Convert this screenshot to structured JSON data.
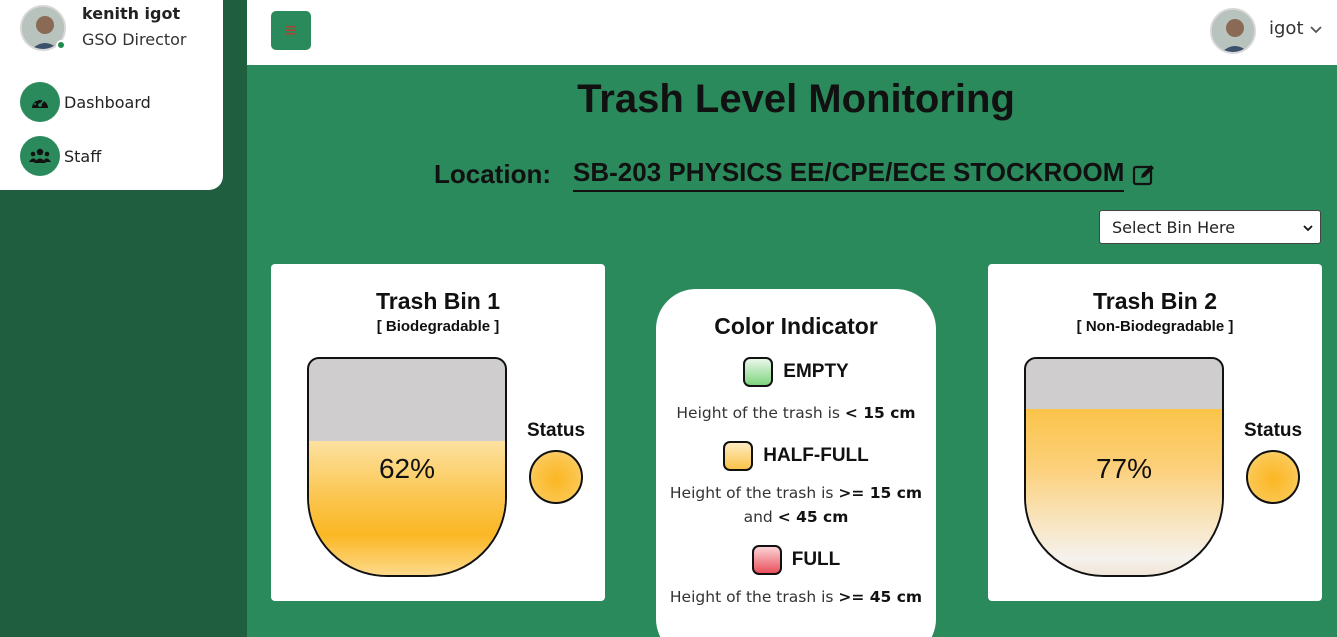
{
  "profile": {
    "name": "kenith igot",
    "role": "GSO Director"
  },
  "nav": [
    {
      "label": "Dashboard",
      "icon": "gauge-icon"
    },
    {
      "label": "Staff",
      "icon": "users-icon"
    }
  ],
  "header": {
    "menu_icon": "≡",
    "user_name": "igot"
  },
  "page": {
    "title": "Trash Level Monitoring",
    "location_label": "Location:",
    "location_value": "SB-203 PHYSICS EE/CPE/ECE STOCKROOM",
    "bin_select": "Select Bin Here"
  },
  "bins": [
    {
      "title": "Trash Bin 1",
      "type": "[ Biodegradable ]",
      "percent_label": "62%",
      "level": 0.62,
      "status_label": "Status"
    },
    {
      "title": "Trash Bin 2",
      "type": "[ Non-Biodegradable ]",
      "percent_label": "77%",
      "level": 0.77,
      "status_label": "Status"
    }
  ],
  "legend": {
    "title": "Color Indicator",
    "items": [
      {
        "name": "EMPTY",
        "desc_prefix": "Height of the trash is ",
        "desc_value": "< 15 cm",
        "color": "#7ed37e"
      },
      {
        "name": "HALF-FULL",
        "desc_prefix": "Height of the trash is ",
        "desc_value": ">= 15 cm",
        "desc_mid": "and ",
        "desc_value2": "< 45 cm",
        "color": "#fbc44a"
      },
      {
        "name": "FULL",
        "desc_prefix": "Height of the trash is ",
        "desc_value": ">= 45 cm",
        "color": "#e8505b"
      }
    ]
  },
  "colors": {
    "sidebar": "#1f5e3f",
    "main": "#2b8a5c",
    "fill": "#fbb724"
  }
}
